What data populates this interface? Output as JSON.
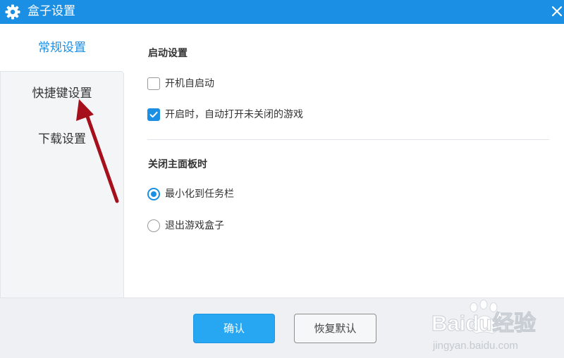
{
  "window": {
    "title": "盒子设置",
    "accent_color": "#1a8fe3"
  },
  "icons": {
    "title": "gear-icon",
    "close": "close-icon"
  },
  "sidebar": {
    "items": [
      {
        "label": "常规设置",
        "active": true
      },
      {
        "label": "快捷键设置",
        "active": false
      },
      {
        "label": "下载设置",
        "active": false
      }
    ]
  },
  "main": {
    "startup": {
      "title": "启动设置",
      "options": [
        {
          "label": "开机自启动",
          "checked": false
        },
        {
          "label": "开启时，自动打开未关闭的游戏",
          "checked": true
        }
      ]
    },
    "close_panel": {
      "title": "关闭主面板时",
      "options": [
        {
          "label": "最小化到任务栏",
          "selected": true
        },
        {
          "label": "退出游戏盒子",
          "selected": false
        }
      ]
    }
  },
  "footer": {
    "confirm_label": "确认",
    "reset_label": "恢复默认"
  },
  "watermark": {
    "logo_text": "Baidu经验",
    "url_text": "jingyan.baidu.com"
  }
}
